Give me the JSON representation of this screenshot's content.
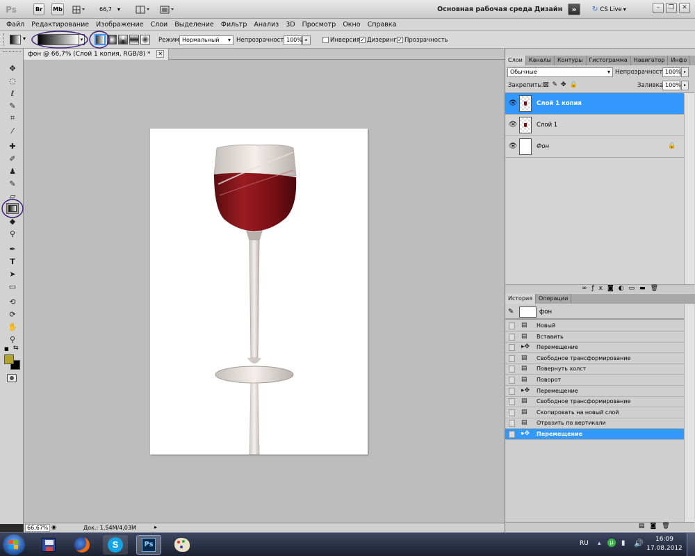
{
  "appbar": {
    "logo": "Ps",
    "br_label": "Br",
    "mb_label": "Mb",
    "zoom_value": "66,7",
    "workspace_label": "Основная рабочая среда",
    "design_label": "Дизайн",
    "more_label": "»",
    "cslive_label": "CS Live"
  },
  "menu": [
    "Файл",
    "Редактирование",
    "Изображение",
    "Слои",
    "Выделение",
    "Фильтр",
    "Анализ",
    "3D",
    "Просмотр",
    "Окно",
    "Справка"
  ],
  "options": {
    "mode_label": "Режим:",
    "mode_value": "Нормальный",
    "opacity_label": "Непрозрачность:",
    "opacity_value": "100%",
    "inversion_label": "Инверсия",
    "inversion_checked": false,
    "dither_label": "Дизеринг",
    "dither_checked": true,
    "transparency_label": "Прозрачность",
    "transparency_checked": true
  },
  "document": {
    "tab_title": "фон @ 66,7% (Слой 1 копия, RGB/8) *",
    "tab_close": "✕"
  },
  "status": {
    "zoom": "66.67%",
    "doc_info": "Док.: 1,54M/4,03M"
  },
  "layers_panel": {
    "tabs": [
      "Слои",
      "Каналы",
      "Контуры",
      "Гистограмма",
      "Навигатор",
      "Инфо"
    ],
    "blend_mode": "Обычные",
    "opacity_label": "Непрозрачность:",
    "opacity_value": "100%",
    "lock_label": "Закрепить:",
    "fill_label": "Заливка:",
    "fill_value": "100%",
    "layers": [
      {
        "name": "Слой 1 копия",
        "selected": true
      },
      {
        "name": "Слой 1",
        "selected": false
      },
      {
        "name": "Фон",
        "selected": false
      }
    ]
  },
  "history_panel": {
    "tabs": [
      "История",
      "Операции"
    ],
    "snapshot_name": "фон",
    "items": [
      {
        "name": "Новый",
        "icon": "document-icon"
      },
      {
        "name": "Вставить",
        "icon": "document-icon"
      },
      {
        "name": "Перемещение",
        "icon": "move-icon"
      },
      {
        "name": "Свободное трансформирование",
        "icon": "document-icon"
      },
      {
        "name": "Повернуть холст",
        "icon": "document-icon"
      },
      {
        "name": "Поворот",
        "icon": "document-icon"
      },
      {
        "name": "Перемещение",
        "icon": "move-icon"
      },
      {
        "name": "Свободное трансформирование",
        "icon": "document-icon"
      },
      {
        "name": "Скопировать на новый слой",
        "icon": "document-icon"
      },
      {
        "name": "Отразить по вертикали",
        "icon": "document-icon"
      },
      {
        "name": "Перемещение",
        "icon": "move-icon",
        "selected": true
      }
    ]
  },
  "colors": {
    "selection": "#3399ff",
    "foreground_swatch": "#b3a42c",
    "background_swatch": "#000000",
    "annotation_circle": "#3a1a7a"
  },
  "taskbar": {
    "lang": "RU",
    "time": "16:09",
    "date": "17.08.2012",
    "ps_label": "Ps"
  }
}
